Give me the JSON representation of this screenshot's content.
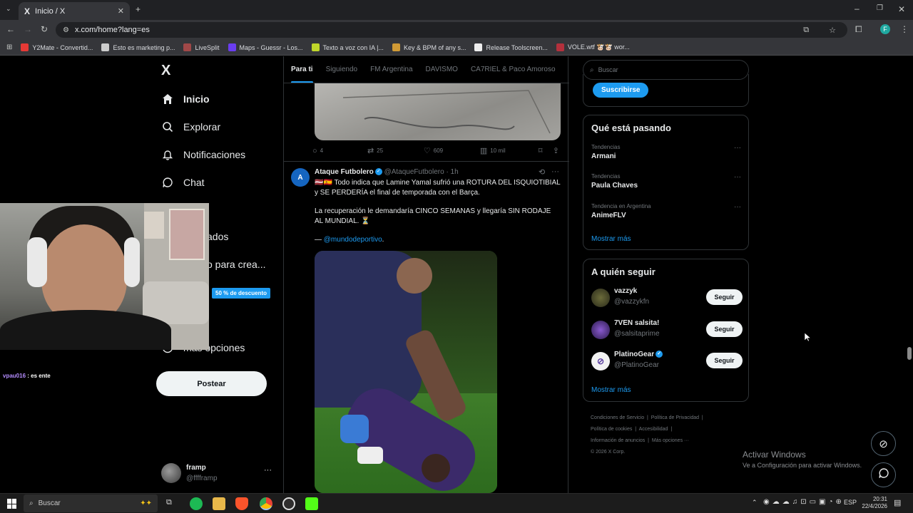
{
  "browser": {
    "tab_title": "Inicio / X",
    "tab_favicon": "X",
    "url": "x.com/home?lang=es",
    "profile_initial": "F",
    "bookmarks": [
      {
        "label": "Y2Mate - Convertid...",
        "color": "#e53935"
      },
      {
        "label": "Esto es marketing p...",
        "color": "#cccccc"
      },
      {
        "label": "LiveSplit",
        "color": "#a04848"
      },
      {
        "label": "Maps - Guessr - Los...",
        "color": "#6a3df0"
      },
      {
        "label": "Texto a voz con IA |...",
        "color": "#c0d62a"
      },
      {
        "label": "Key & BPM of any s...",
        "color": "#d09a35"
      },
      {
        "label": "Release Toolscreen...",
        "color": "#eeeeee"
      },
      {
        "label": "VOLE.wtf 🐮🐮 wor...",
        "color": "#b3303c"
      }
    ]
  },
  "nav": {
    "logo": "X",
    "items": [
      {
        "label": "Inicio",
        "icon": "home-icon"
      },
      {
        "label": "Explorar",
        "icon": "search-icon"
      },
      {
        "label": "Notificaciones",
        "icon": "bell-icon"
      },
      {
        "label": "Chat",
        "icon": "chat-icon"
      },
      {
        "label": "ados",
        "icon": "bookmark-icon"
      },
      {
        "label": "o para crea...",
        "icon": "creator-icon"
      },
      {
        "label": "más opciones",
        "icon": "more-icon"
      }
    ],
    "premium_badge": "50 % de descuento",
    "post_button": "Postear",
    "account": {
      "name": "framp",
      "handle": "@fffframp",
      "more": "···"
    }
  },
  "stream_overlay": {
    "chat_user": "vpau016",
    "chat_message": "es ente"
  },
  "feed": {
    "tabs": [
      "Para ti",
      "Siguiendo",
      "FM Argentina",
      "DAVISMO",
      "CA7RIEL & Paco Amoroso"
    ],
    "prev_post_actions": {
      "replies": "4",
      "reposts": "25",
      "likes": "609",
      "views": "10 mil"
    },
    "post": {
      "author": "Ataque Futbolero",
      "handle": "@AtaqueFutbolero",
      "time": "· 1h",
      "line1": "🇱🇻🇪🇸 Todo indica que Lamine Yamal sufrió una ROTURA DEL ISQUIOTIBIAL y SE PERDERÍA el final de temporada con el Barça.",
      "line2": "La recuperación le demandaría CINCO SEMANAS y llegaría SIN RODAJE AL MUNDIAL. ⏳",
      "credit_prefix": "— ",
      "credit_link": "@mundodeportivo",
      "credit_suffix": "."
    }
  },
  "right": {
    "search_placeholder": "Buscar",
    "subscribe_label": "Suscribirse",
    "trends_title": "Qué está pasando",
    "trends": [
      {
        "context": "Tendencias",
        "name": "Armani"
      },
      {
        "context": "Tendencias",
        "name": "Paula Chaves"
      },
      {
        "context": "Tendencia en Argentina",
        "name": "AnimeFLV"
      }
    ],
    "trends_more": "Mostrar más",
    "follow_title": "A quién seguir",
    "follow": [
      {
        "name": "vazzyk",
        "handle": "@vazzykfn",
        "button": "Seguir",
        "verified": false
      },
      {
        "name": "7VEN salsita!",
        "handle": "@salsitaprime",
        "button": "Seguir",
        "verified": false
      },
      {
        "name": "PlatinoGear",
        "handle": "@PlatinoGear",
        "button": "Seguir",
        "verified": true
      }
    ],
    "follow_more": "Mostrar más",
    "footer": {
      "l1a": "Condiciones de Servicio",
      "l1b": "Política de Privacidad",
      "l2a": "Política de cookies",
      "l2b": "Accesibilidad",
      "l3a": "Información de anuncios",
      "l3b": "Más opciones ···",
      "copyright": "© 2026 X Corp."
    }
  },
  "watermark": {
    "title": "Activar Windows",
    "sub": "Ve a Configuración para activar Windows."
  },
  "taskbar": {
    "search": "Buscar",
    "lang": "ESP",
    "time": "20:31",
    "date": "22/4/2026"
  }
}
